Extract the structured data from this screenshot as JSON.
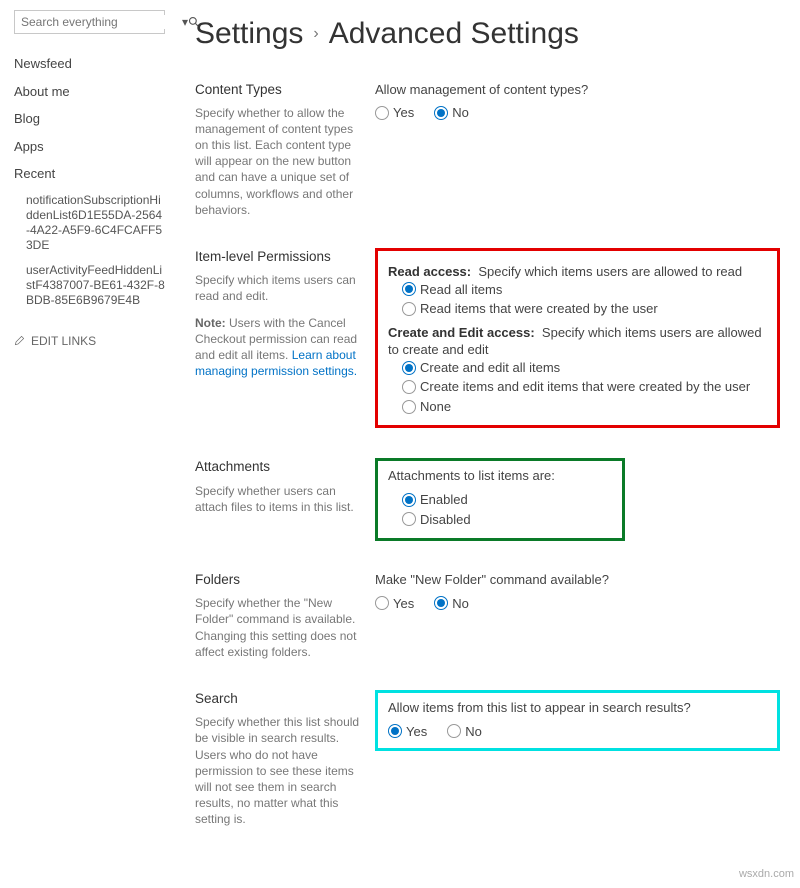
{
  "search": {
    "placeholder": "Search everything"
  },
  "nav": {
    "newsfeed": "Newsfeed",
    "about": "About me",
    "blog": "Blog",
    "apps": "Apps",
    "recent": "Recent",
    "r1": "notificationSubscriptionHiddenList6D1E55DA-2564-4A22-A5F9-6C4FCAFF53DE",
    "r2": "userActivityFeedHiddenListF4387007-BE61-432F-8BDB-85E6B9679E4B",
    "edit": "EDIT LINKS"
  },
  "header": {
    "a": "Settings",
    "b": "Advanced Settings"
  },
  "ct": {
    "title": "Content Types",
    "desc": "Specify whether to allow the management of content types on this list. Each content type will appear on the new button and can have a unique set of columns, workflows and other behaviors.",
    "q": "Allow management of content types?",
    "yes": "Yes",
    "no": "No"
  },
  "ilp": {
    "title": "Item-level Permissions",
    "desc": "Specify which items users can read and edit.",
    "noteLabel": "Note:",
    "note": " Users with the Cancel Checkout permission can read and edit all items. ",
    "link": "Learn about managing permission settings.",
    "readH": "Read access:",
    "readD": "Specify which items users are allowed to read",
    "r1": "Read all items",
    "r2": "Read items that were created by the user",
    "ceH": "Create and Edit access:",
    "ceD": "Specify which items users are allowed to create and edit",
    "c1": "Create and edit all items",
    "c2": "Create items and edit items that were created by the user",
    "c3": "None"
  },
  "att": {
    "title": "Attachments",
    "desc": "Specify whether users can attach files to items in this list.",
    "q": "Attachments to list items are:",
    "e": "Enabled",
    "d": "Disabled"
  },
  "fold": {
    "title": "Folders",
    "desc": "Specify whether the \"New Folder\" command is available. Changing this setting does not affect existing folders.",
    "q": "Make \"New Folder\" command available?",
    "yes": "Yes",
    "no": "No"
  },
  "srch": {
    "title": "Search",
    "desc": "Specify whether this list should be visible in search results. Users who do not have permission to see these items will not see them in search results, no matter what this setting is.",
    "q": "Allow items from this list to appear in search results?",
    "yes": "Yes",
    "no": "No"
  },
  "watermark": "wsxdn.com"
}
